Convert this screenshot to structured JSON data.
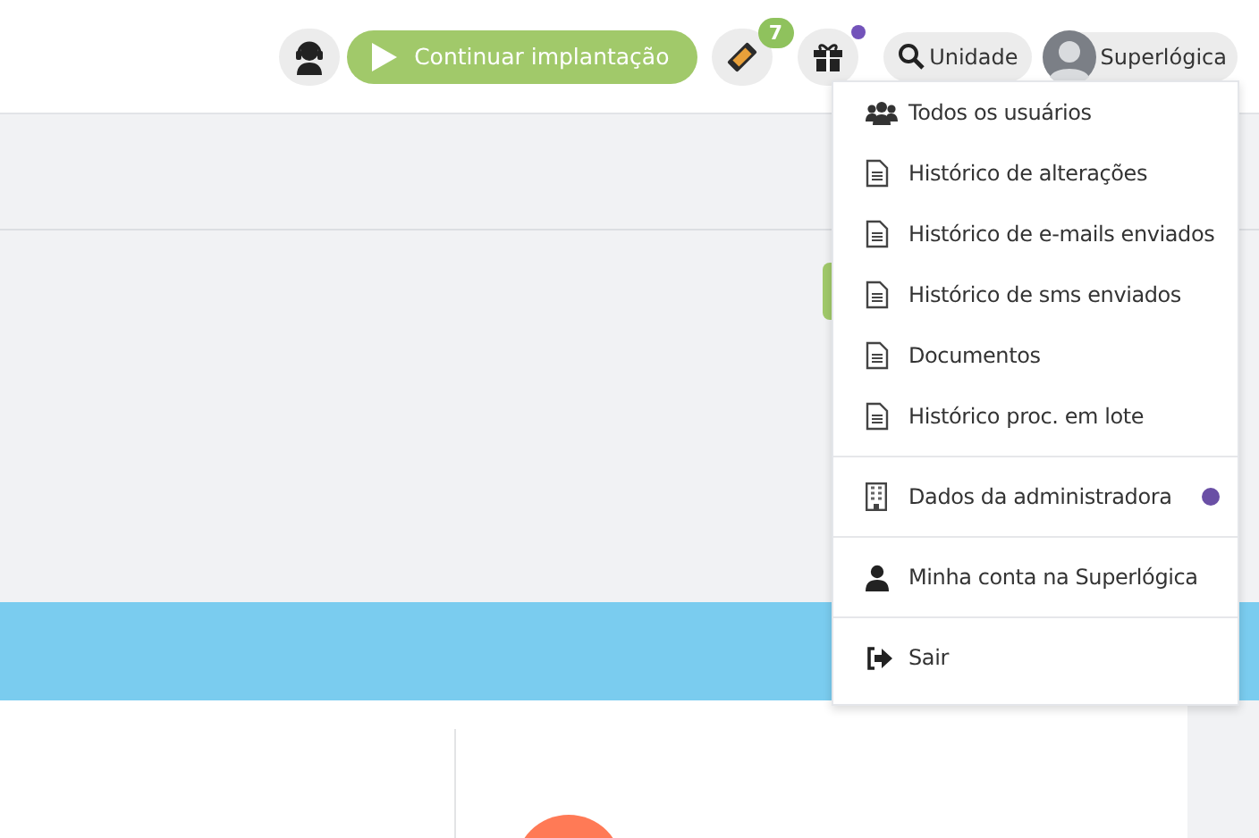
{
  "header": {
    "continue_button": "Continuar implantação",
    "ticket_badge": "7",
    "gift_notification": true,
    "unit_button": "Unidade",
    "user_button": "Superlógica"
  },
  "user_menu": {
    "groups": [
      {
        "items": [
          {
            "kind": "users",
            "label": "Todos os usuários",
            "dot": false
          },
          {
            "kind": "document",
            "label": "Histórico de alterações",
            "dot": false
          },
          {
            "kind": "document",
            "label": "Histórico de e-mails enviados",
            "dot": false
          },
          {
            "kind": "document",
            "label": "Histórico de sms enviados",
            "dot": false
          },
          {
            "kind": "document",
            "label": "Documentos",
            "dot": false
          },
          {
            "kind": "document",
            "label": "Histórico proc. em lote",
            "dot": false
          }
        ]
      },
      {
        "items": [
          {
            "kind": "building",
            "label": "Dados da administradora",
            "dot": true
          }
        ]
      },
      {
        "items": [
          {
            "kind": "user",
            "label": "Minha conta na Superlógica",
            "dot": false
          }
        ]
      },
      {
        "items": [
          {
            "kind": "signout",
            "label": "Sair",
            "dot": false
          }
        ]
      }
    ]
  }
}
